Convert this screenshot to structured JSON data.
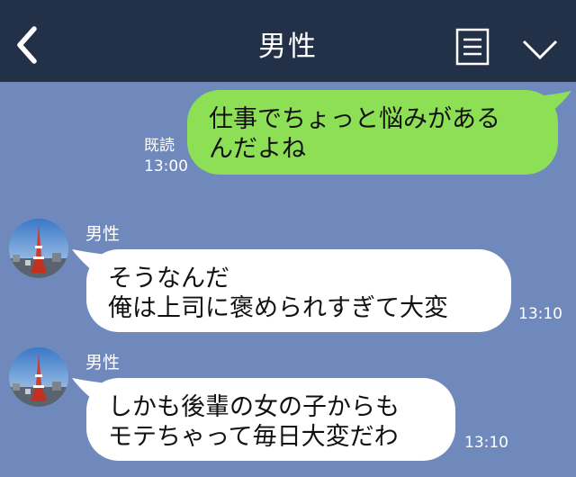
{
  "header": {
    "title": "男性",
    "back_icon": "chevron-left-icon",
    "menu_icon": "note-menu-icon",
    "expand_icon": "chevron-down-icon"
  },
  "colors": {
    "header_bg": "#223048",
    "chat_bg": "#7089bd",
    "outgoing_bubble": "#8de055",
    "incoming_bubble": "#ffffff"
  },
  "messages": [
    {
      "direction": "outgoing",
      "lines": [
        "仕事でちょっと悩みがある",
        "んだよね"
      ],
      "read_label": "既読",
      "time": "13:00"
    },
    {
      "direction": "incoming",
      "sender": "男性",
      "lines": [
        "そうなんだ",
        "俺は上司に褒められすぎて大変"
      ],
      "time": "13:10"
    },
    {
      "direction": "incoming",
      "sender": "男性",
      "lines": [
        "しかも後輩の女の子からも",
        "モテちゃって毎日大変だわ"
      ],
      "time": "13:10"
    }
  ]
}
